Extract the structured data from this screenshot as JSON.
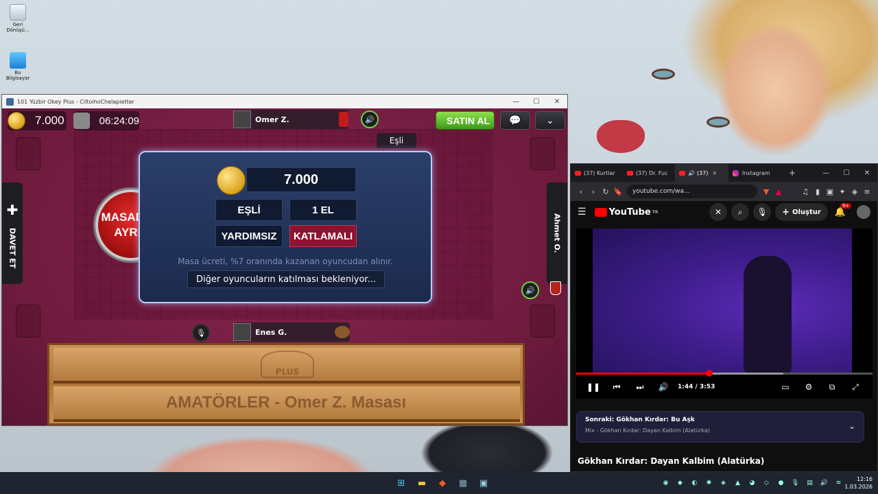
{
  "desktop": {
    "icons": [
      {
        "label": "Geri Dönüşü...",
        "icon": "recycle-bin-icon"
      },
      {
        "label": "Bu Bilgisayar",
        "icon": "computer-icon"
      }
    ]
  },
  "game": {
    "window_title": "101 Yüzbir Okey Plus - CiltoihoChelapietter",
    "chips": "7.000",
    "timer": "06:24:09",
    "top_player": "Omer Z.",
    "right_player": "Ahmet O.",
    "bottom_player": "Enes G.",
    "partner_label": "Eşli",
    "buy_button": "SATIN AL",
    "invite_label": "DAVET ET",
    "leave_button_line1": "MASADAN",
    "leave_button_line2": "AYRIL",
    "dialog": {
      "stake": "7.000",
      "mode": "EŞLİ",
      "rounds": "1 EL",
      "help": "YARDIMSIZ",
      "multiplier": "KATLAMALI",
      "fee_note": "Masa ücreti, %7 oranında kazanan oyuncudan alınır.",
      "waiting": "Diğer oyuncuların katılması bekleniyor..."
    },
    "rack_logo": "PLUS",
    "rack_caption": "AMATÖRLER - Omer Z. Masası"
  },
  "browser": {
    "tabs": [
      {
        "label": "(37) Kurtlar"
      },
      {
        "label": "(37) Dr. Fuc"
      },
      {
        "label": "(37)"
      },
      {
        "label": "Instagram"
      }
    ],
    "url": "youtube.com/wa...",
    "yt_logo": "YouTube",
    "yt_region": "TR",
    "create_label": "Oluştur",
    "notif_count": "9+",
    "player": {
      "time": "1:44 / 3:53",
      "played_fraction": 0.45,
      "buffered_fraction": 0.7
    },
    "next_title": "Sonraki: Gökhan Kırdar: Bu Aşk",
    "next_sub": "Mix - Gökhan Kırdar: Dayan Kalbim (Alatürka)",
    "video_title": "Gökhan Kırdar: Dayan Kalbim (Alatürka)"
  },
  "taskbar": {
    "time": "12:16",
    "date": "1.03.2026"
  },
  "colors": {
    "felt": "#7a1e40",
    "yt_red": "#ff0000",
    "satin_green": "#4fb026"
  }
}
